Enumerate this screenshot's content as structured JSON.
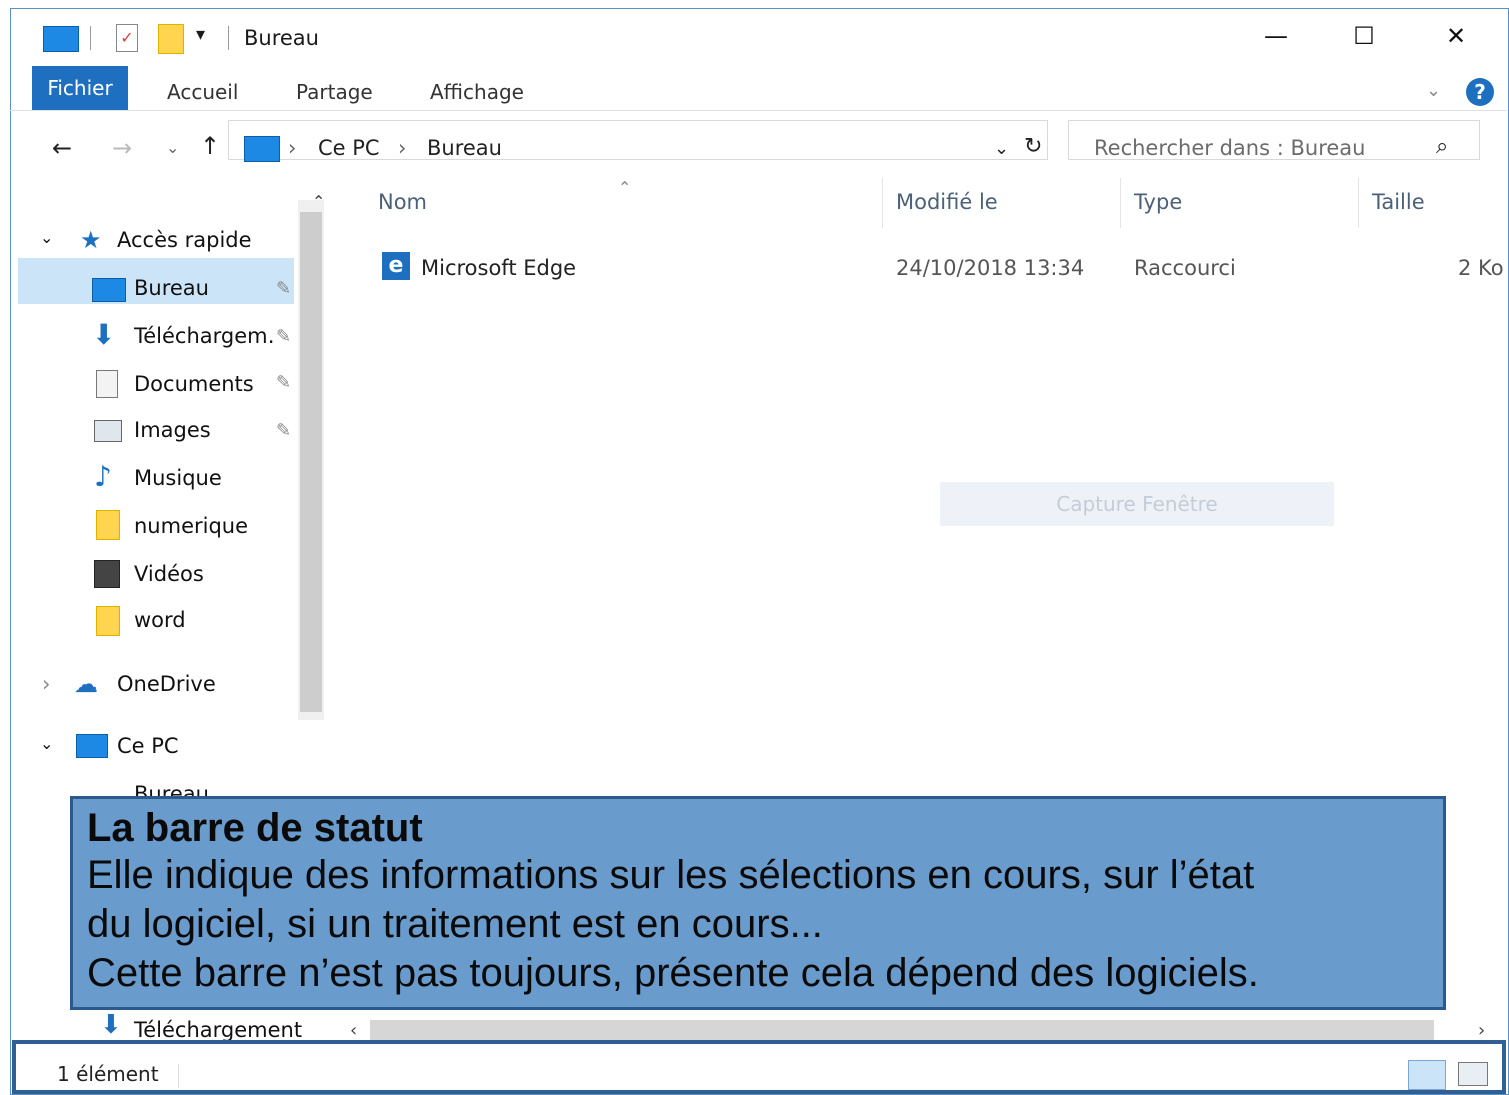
{
  "titlebar": {
    "title": "Bureau",
    "minimize": "—",
    "maximize": "☐",
    "close": "✕"
  },
  "ribbon": {
    "file": "Fichier",
    "tabs": [
      "Accueil",
      "Partage",
      "Affichage"
    ]
  },
  "address": {
    "crumbs": [
      "Ce PC",
      "Bureau"
    ],
    "search_placeholder": "Rechercher dans : Bureau"
  },
  "nav": {
    "quick_access": "Accès rapide",
    "items": [
      {
        "label": "Bureau",
        "icon": "desktop-icon",
        "pinned": true
      },
      {
        "label": "Téléchargem…",
        "icon": "download-icon",
        "pinned": true
      },
      {
        "label": "Documents",
        "icon": "document-icon",
        "pinned": true
      },
      {
        "label": "Images",
        "icon": "image-icon",
        "pinned": true
      },
      {
        "label": "Musique",
        "icon": "music-icon",
        "pinned": false
      },
      {
        "label": "numerique",
        "icon": "folder-icon",
        "pinned": false
      },
      {
        "label": "Vidéos",
        "icon": "video-icon",
        "pinned": false
      },
      {
        "label": "word",
        "icon": "folder-icon",
        "pinned": false
      }
    ],
    "onedrive": "OneDrive",
    "this_pc": "Ce PC",
    "pc_items": [
      "Bureau",
      "Téléchargement"
    ]
  },
  "list": {
    "columns": [
      "Nom",
      "Modifié le",
      "Type",
      "Taille"
    ],
    "rows": [
      {
        "name": "Microsoft Edge",
        "modified": "24/10/2018 13:34",
        "type": "Raccourci",
        "size": "2 Ko"
      }
    ]
  },
  "watermark": "Capture Fenêtre",
  "note": {
    "title": "La barre de statut",
    "line1": "Elle indique des informations sur les sélections en cours, sur l’état",
    "line2": "du logiciel, si un traitement est en cours...",
    "line3": "Cette barre n’est pas toujours, présente cela dépend des logiciels."
  },
  "status": {
    "count": "1 élément"
  },
  "colors": {
    "accent": "#1e6fbf",
    "note_bg": "#6a9bcd",
    "note_border": "#2b5a8f",
    "selection": "#cce4f7"
  }
}
